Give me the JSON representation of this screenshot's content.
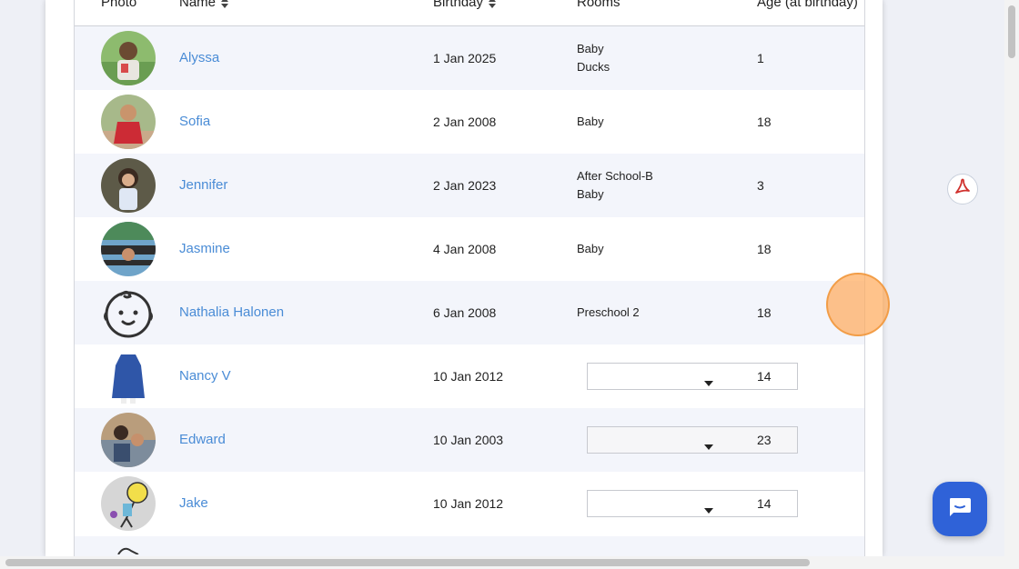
{
  "table": {
    "headers": {
      "photo": "Photo",
      "name": "Name",
      "birthday": "Birthday",
      "rooms": "Rooms",
      "age": "Age (at birthday)"
    }
  },
  "rows": [
    {
      "name": "Alyssa",
      "birthday": "1 Jan 2025",
      "rooms": [
        "Baby",
        "Ducks"
      ],
      "age": "1"
    },
    {
      "name": "Sofia",
      "birthday": "2 Jan 2008",
      "rooms": [
        "Baby"
      ],
      "age": "18"
    },
    {
      "name": "Jennifer",
      "birthday": "2 Jan 2023",
      "rooms": [
        "After School-B",
        "Baby"
      ],
      "age": "3"
    },
    {
      "name": "Jasmine",
      "birthday": "4 Jan 2008",
      "rooms": [
        "Baby"
      ],
      "age": "18"
    },
    {
      "name": "Nathalia Halonen",
      "birthday": "6 Jan 2008",
      "rooms": [
        "Preschool 2"
      ],
      "age": "18"
    },
    {
      "name": "Nancy V",
      "birthday": "10 Jan 2012",
      "room_select": "",
      "age": "14"
    },
    {
      "name": "Edward",
      "birthday": "10 Jan 2003",
      "room_select": "",
      "age": "23"
    },
    {
      "name": "Jake",
      "birthday": "10 Jan 2012",
      "room_select": "",
      "age": "14"
    }
  ],
  "icons": {
    "pdf": "pdf-icon",
    "chat": "chat-icon",
    "sort": "sort-icon",
    "dropdown": "caret-down-icon",
    "default_avatar": "baby-face-icon"
  },
  "colors": {
    "link": "#4a8cd6",
    "row_alt": "#f3f5fb",
    "chat_button": "#2f62d8",
    "pdf_red": "#d0312d",
    "cursor_highlight": "#f7a65a"
  }
}
